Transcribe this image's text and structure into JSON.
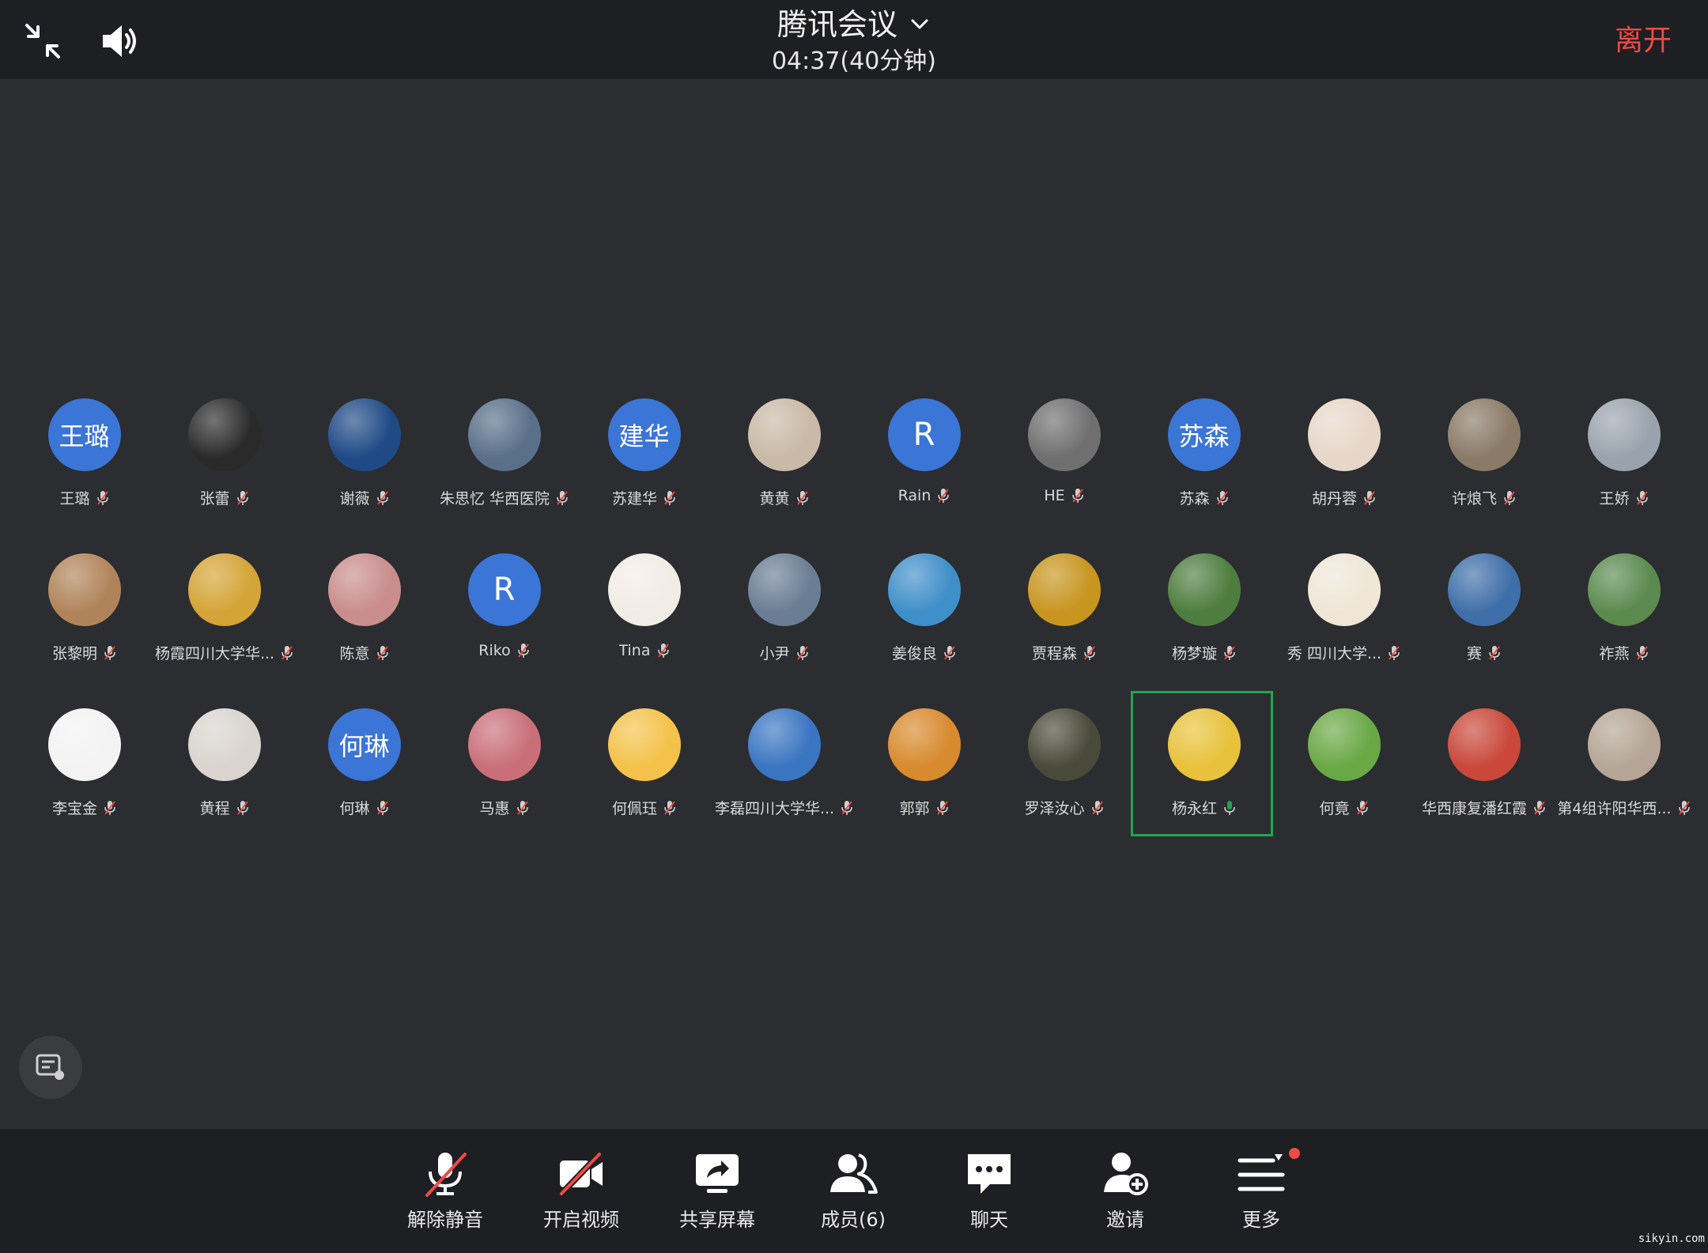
{
  "app": {
    "title": "腾讯会议",
    "subtitle": "04:37(40分钟)",
    "leave_label": "离开"
  },
  "colors": {
    "background": "#2b2d30",
    "bar": "#1e1f22",
    "accent_blue": "#3b75d6",
    "leave_red": "#f04a45",
    "speaking_green": "#23a352"
  },
  "participants": [
    {
      "name": "王璐",
      "avatar_text": "王璐",
      "avatar_color": "#3b75d6"
    },
    {
      "name": "张蕾",
      "avatar_text": "",
      "avatar_color": "#2a2a2a"
    },
    {
      "name": "谢薇",
      "avatar_text": "",
      "avatar_color": "#1f4a86"
    },
    {
      "name": "朱思忆 华西医院",
      "avatar_text": "",
      "avatar_color": "#5a6f8a"
    },
    {
      "name": "苏建华",
      "avatar_text": "建华",
      "avatar_color": "#3b75d6"
    },
    {
      "name": "黄黄",
      "avatar_text": "",
      "avatar_color": "#c9b9a7"
    },
    {
      "name": "Rain",
      "avatar_text": "R",
      "avatar_color": "#3b75d6"
    },
    {
      "name": "HE",
      "avatar_text": "",
      "avatar_color": "#6f6f6f"
    },
    {
      "name": "苏森",
      "avatar_text": "苏森",
      "avatar_color": "#3b75d6"
    },
    {
      "name": "胡丹蓉",
      "avatar_text": "",
      "avatar_color": "#e7d7c9"
    },
    {
      "name": "许烺飞",
      "avatar_text": "",
      "avatar_color": "#8a7a68"
    },
    {
      "name": "王娇",
      "avatar_text": "",
      "avatar_color": "#9aa3ad"
    },
    {
      "name": "张黎明",
      "avatar_text": "",
      "avatar_color": "#b0845a"
    },
    {
      "name": "杨霞四川大学华...",
      "avatar_text": "",
      "avatar_color": "#d4a437"
    },
    {
      "name": "陈意",
      "avatar_text": "",
      "avatar_color": "#c98d8d"
    },
    {
      "name": "Riko",
      "avatar_text": "R",
      "avatar_color": "#3b75d6"
    },
    {
      "name": "Tina",
      "avatar_text": "",
      "avatar_color": "#f2ece6"
    },
    {
      "name": "小尹",
      "avatar_text": "",
      "avatar_color": "#6a7d94"
    },
    {
      "name": "姜俊良",
      "avatar_text": "",
      "avatar_color": "#3f8fc9"
    },
    {
      "name": "贾程森",
      "avatar_text": "",
      "avatar_color": "#c8951f"
    },
    {
      "name": "杨梦璇",
      "avatar_text": "",
      "avatar_color": "#4f7d3f"
    },
    {
      "name": "秀 四川大学...",
      "avatar_text": "",
      "avatar_color": "#efe6d6"
    },
    {
      "name": "赛",
      "avatar_text": "",
      "avatar_color": "#3f6fa8"
    },
    {
      "name": "祚燕",
      "avatar_text": "",
      "avatar_color": "#5b8a4f"
    },
    {
      "name": "李宝金",
      "avatar_text": "",
      "avatar_color": "#f3f3f3"
    },
    {
      "name": "黄程",
      "avatar_text": "",
      "avatar_color": "#d9d4cf"
    },
    {
      "name": "何琳",
      "avatar_text": "何琳",
      "avatar_color": "#3b75d6"
    },
    {
      "name": "马惠",
      "avatar_text": "",
      "avatar_color": "#c96f7a"
    },
    {
      "name": "何佩珏",
      "avatar_text": "",
      "avatar_color": "#f4c24a"
    },
    {
      "name": "李磊四川大学华...",
      "avatar_text": "",
      "avatar_color": "#3a75c2"
    },
    {
      "name": "郭郭",
      "avatar_text": "",
      "avatar_color": "#d88a2e"
    },
    {
      "name": "罗泽汝心",
      "avatar_text": "",
      "avatar_color": "#4a4a3a"
    },
    {
      "name": "杨永红",
      "avatar_text": "",
      "avatar_color": "#e8c23a",
      "speaking": true
    },
    {
      "name": "何竟",
      "avatar_text": "",
      "avatar_color": "#6aa845"
    },
    {
      "name": "华西康复潘红霞",
      "avatar_text": "",
      "avatar_color": "#c9483a"
    },
    {
      "name": "第4组许阳华西...",
      "avatar_text": "",
      "avatar_color": "#b5a596"
    }
  ],
  "toolbar": [
    {
      "label": "解除静音",
      "icon": "mic-muted-icon"
    },
    {
      "label": "开启视频",
      "icon": "video-off-icon"
    },
    {
      "label": "共享屏幕",
      "icon": "share-screen-icon"
    },
    {
      "label": "成员(6)",
      "icon": "members-icon"
    },
    {
      "label": "聊天",
      "icon": "chat-icon"
    },
    {
      "label": "邀请",
      "icon": "invite-icon"
    },
    {
      "label": "更多",
      "icon": "more-icon"
    }
  ],
  "watermark": "sikyin.com"
}
